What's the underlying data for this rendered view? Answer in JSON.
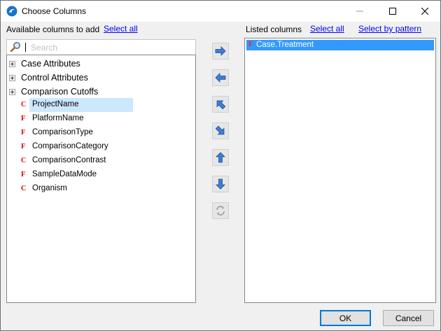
{
  "window": {
    "title": "Choose Columns"
  },
  "available": {
    "label": "Available columns to add",
    "select_all": "Select all",
    "search_placeholder": "Search",
    "groups": [
      "Case Attributes",
      "Control Attributes",
      "Comparison Cutoffs"
    ],
    "fields": [
      {
        "type": "C",
        "name": "ProjectName"
      },
      {
        "type": "F",
        "name": "PlatformName"
      },
      {
        "type": "F",
        "name": "ComparisonType"
      },
      {
        "type": "F",
        "name": "ComparisonCategory"
      },
      {
        "type": "C",
        "name": "ComparisonContrast"
      },
      {
        "type": "F",
        "name": "SampleDataMode"
      },
      {
        "type": "C",
        "name": "Organism"
      }
    ]
  },
  "listed": {
    "label": "Listed columns",
    "select_all": "Select all",
    "select_by_pattern": "Select by pattern",
    "items": [
      {
        "type": "F",
        "name": "Case.Treatment"
      }
    ]
  },
  "buttons": {
    "ok": "OK",
    "cancel": "Cancel"
  },
  "icons": {
    "add": "arrow-right-icon",
    "remove": "arrow-left-icon",
    "move_top": "arrow-up-left-icon",
    "move_bottom": "arrow-down-right-icon",
    "move_up": "arrow-up-icon",
    "move_down": "arrow-down-icon",
    "reset": "refresh-icon"
  },
  "colors": {
    "arrow": "#3b7fd6",
    "selection": "#3399ff",
    "hover": "#cce8ff",
    "type_icon": "#cc0000"
  }
}
